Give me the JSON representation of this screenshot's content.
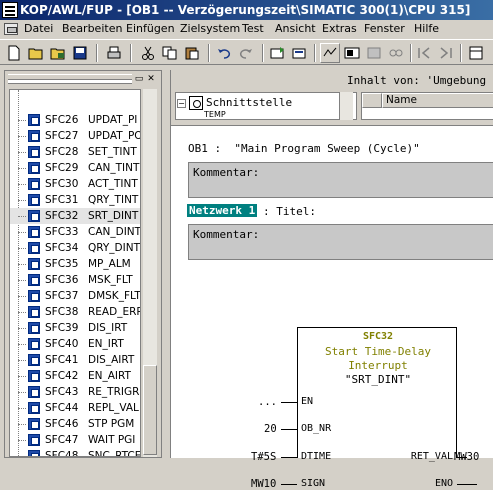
{
  "window": {
    "title": "KOP/AWL/FUP - [OB1 -- Verzögerungszeit\\SIMATIC 300(1)\\CPU 315]"
  },
  "menu": [
    "Datei",
    "Bearbeiten",
    "Einfügen",
    "Zielsystem",
    "Test",
    "Ansicht",
    "Extras",
    "Fenster",
    "Hilfe"
  ],
  "toolbar": {
    "icons": [
      "new-icon",
      "open-icon",
      "open-online-icon",
      "save-icon",
      "print-icon",
      "cut-icon",
      "copy-icon",
      "paste-icon",
      "undo-icon",
      "redo-icon",
      "download-icon",
      "online-offline-icon",
      "monitor-icon",
      "breakpoint-icon",
      "fbd-icon",
      "stl-icon",
      "ladder-icon",
      "prev-icon",
      "next-icon",
      "function-block-icon",
      "network-icon"
    ]
  },
  "tree": {
    "items": [
      {
        "name": "SFC26",
        "desc": "UPDAT_PI"
      },
      {
        "name": "SFC27",
        "desc": "UPDAT_PO"
      },
      {
        "name": "SFC28",
        "desc": "SET_TINT"
      },
      {
        "name": "SFC29",
        "desc": "CAN_TINT"
      },
      {
        "name": "SFC30",
        "desc": "ACT_TINT"
      },
      {
        "name": "SFC31",
        "desc": "QRY_TINT"
      },
      {
        "name": "SFC32",
        "desc": "SRT_DINT"
      },
      {
        "name": "SFC33",
        "desc": "CAN_DINT"
      },
      {
        "name": "SFC34",
        "desc": "QRY_DINT"
      },
      {
        "name": "SFC35",
        "desc": "MP_ALM"
      },
      {
        "name": "SFC36",
        "desc": "MSK_FLT"
      },
      {
        "name": "SFC37",
        "desc": "DMSK_FLT"
      },
      {
        "name": "SFC38",
        "desc": "READ_ERR"
      },
      {
        "name": "SFC39",
        "desc": "DIS_IRT"
      },
      {
        "name": "SFC40",
        "desc": "EN_IRT"
      },
      {
        "name": "SFC41",
        "desc": "DIS_AIRT"
      },
      {
        "name": "SFC42",
        "desc": "EN_AIRT"
      },
      {
        "name": "SFC43",
        "desc": "RE_TRIGR"
      },
      {
        "name": "SFC44",
        "desc": "REPL_VAL"
      },
      {
        "name": "SFC46",
        "desc": "STP  PGM"
      },
      {
        "name": "SFC47",
        "desc": "WAIT  PGI"
      },
      {
        "name": "SFC48",
        "desc": "SNC_RTCE"
      }
    ]
  },
  "info": {
    "inhalt": "Inhalt von: 'Umgebung"
  },
  "interface": {
    "label": "Schnittstelle",
    "sub": "TEMP"
  },
  "namecol": {
    "header": "Name"
  },
  "editor": {
    "ob_title": "OB1 :  \"Main Program Sweep (Cycle)\"",
    "comment1": "Kommentar:",
    "network": "Netzwerk 1",
    "network_title": ": Titel:",
    "comment2": "Kommentar:"
  },
  "block": {
    "name": "SFC32",
    "line1": "Start Time-Delay",
    "line2": "Interrupt",
    "line3": "\"SRT_DINT\"",
    "pins_in": [
      "EN",
      "OB_NR",
      "DTIME",
      "SIGN"
    ],
    "pins_out": [
      "RET_VAL",
      "ENO"
    ],
    "in_values": [
      "...",
      "20",
      "T#5S",
      "MW10"
    ],
    "out_values": [
      "MW30"
    ]
  },
  "colors": {
    "titlebar": "#0a246a",
    "network": "#008080",
    "block_title": "#808000",
    "tree_icon": "#1f4aa8"
  }
}
